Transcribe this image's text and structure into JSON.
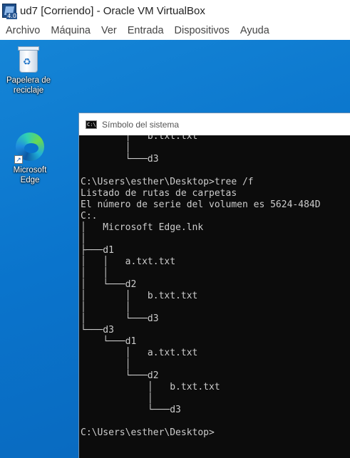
{
  "host": {
    "title": "ud7 [Corriendo] - Oracle VM VirtualBox",
    "icon": "virtualbox-icon",
    "menu": [
      "Archivo",
      "Máquina",
      "Ver",
      "Entrada",
      "Dispositivos",
      "Ayuda"
    ]
  },
  "desktop": {
    "icons": [
      {
        "label_line1": "Papelera de",
        "label_line2": "reciclaje",
        "icon": "recycle-bin-icon"
      },
      {
        "label": "Microsoft Edge",
        "icon": "edge-icon"
      }
    ]
  },
  "cmd": {
    "title": "Símbolo del sistema",
    "lines": [
      "        │   b.txt.txt",
      "        │",
      "        └───d3",
      "",
      "C:\\Users\\esther\\Desktop>tree /f",
      "Listado de rutas de carpetas",
      "El número de serie del volumen es 5624-484D",
      "C:.",
      "│   Microsoft Edge.lnk",
      "│",
      "├───d1",
      "│   │   a.txt.txt",
      "│   │",
      "│   └───d2",
      "│       │   b.txt.txt",
      "│       │",
      "│       └───d3",
      "└───d3",
      "    └───d1",
      "        │   a.txt.txt",
      "        │",
      "        └───d2",
      "            │   b.txt.txt",
      "            │",
      "            └───d3",
      "",
      "C:\\Users\\esther\\Desktop>"
    ]
  },
  "colors": {
    "desktop_blue": "#0a74cc",
    "console_bg": "#0c0c0c",
    "console_fg": "#cccccc"
  }
}
